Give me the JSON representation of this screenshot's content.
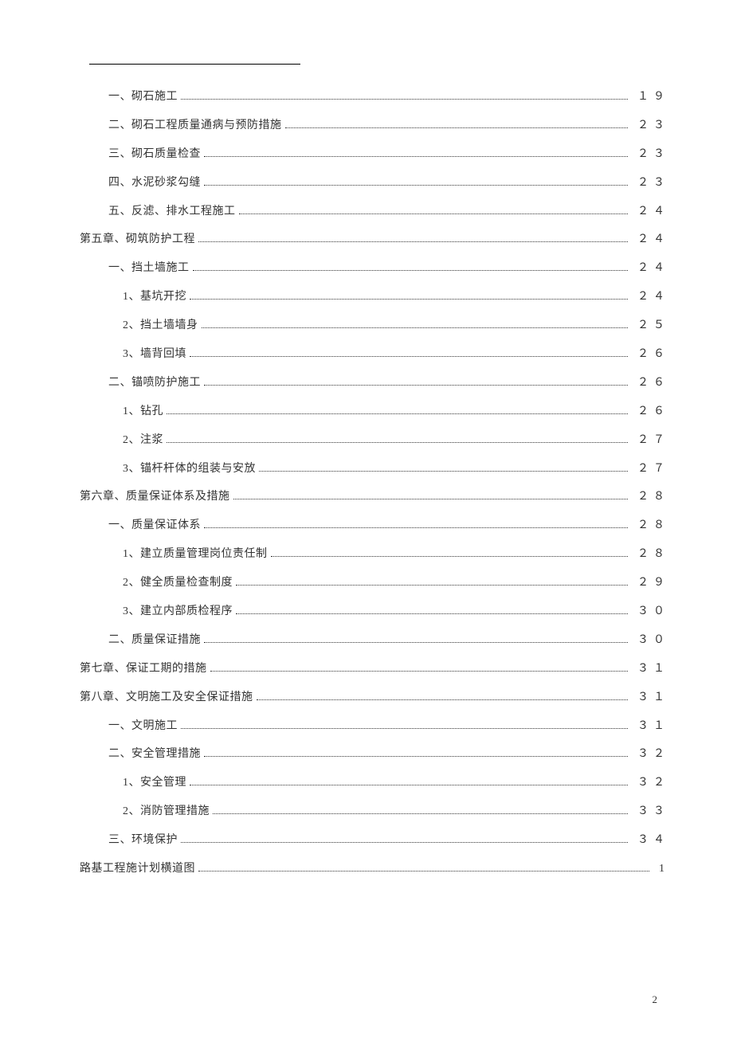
{
  "toc": [
    {
      "title": "一、砌石施工",
      "page": "１９",
      "indent": 1
    },
    {
      "title": "二、砌石工程质量通病与预防措施",
      "page": "２３",
      "indent": 1
    },
    {
      "title": "三、砌石质量检查",
      "page": "２３",
      "indent": 1
    },
    {
      "title": "四、水泥砂浆勾缝",
      "page": "２３",
      "indent": 1
    },
    {
      "title": "五、反滤、排水工程施工",
      "page": "２４",
      "indent": 1
    },
    {
      "title": "第五章、砌筑防护工程",
      "page": "２４",
      "indent": 0
    },
    {
      "title": "一、挡土墙施工",
      "page": "２４",
      "indent": 1
    },
    {
      "title": "1、基坑开挖",
      "page": "２４",
      "indent": 2
    },
    {
      "title": "2、挡土墙墙身",
      "page": "２５",
      "indent": 2
    },
    {
      "title": "3、墙背回填",
      "page": "２６",
      "indent": 2
    },
    {
      "title": "二、锚喷防护施工",
      "page": "２６",
      "indent": 1
    },
    {
      "title": "1、钻孔",
      "page": "２６",
      "indent": 2
    },
    {
      "title": "2、注浆",
      "page": "２７",
      "indent": 2
    },
    {
      "title": "3、锚杆杆体的组装与安放",
      "page": "２７",
      "indent": 2
    },
    {
      "title": "第六章、质量保证体系及措施",
      "page": "２８",
      "indent": 0
    },
    {
      "title": "一、质量保证体系",
      "page": "２８",
      "indent": 1
    },
    {
      "title": "1、建立质量管理岗位责任制",
      "page": "２８",
      "indent": 2
    },
    {
      "title": "2、健全质量检查制度",
      "page": "２９",
      "indent": 2
    },
    {
      "title": "3、建立内部质检程序",
      "page": "３０",
      "indent": 2
    },
    {
      "title": "二、质量保证措施",
      "page": "３０",
      "indent": 1
    },
    {
      "title": "第七章、保证工期的措施",
      "page": "３１",
      "indent": 0
    },
    {
      "title": "第八章、文明施工及安全保证措施",
      "page": "３１",
      "indent": 0
    },
    {
      "title": "一、文明施工",
      "page": "３１",
      "indent": 1
    },
    {
      "title": "二、安全管理措施",
      "page": "３２",
      "indent": 1
    },
    {
      "title": "1、安全管理",
      "page": "３２",
      "indent": 2
    },
    {
      "title": "2、消防管理措施",
      "page": "３３",
      "indent": 2
    },
    {
      "title": "三、环境保护",
      "page": "３４",
      "indent": 1
    },
    {
      "title": "路基工程施计划横道图",
      "page": "1",
      "indent": 0
    }
  ],
  "page_number": "2"
}
